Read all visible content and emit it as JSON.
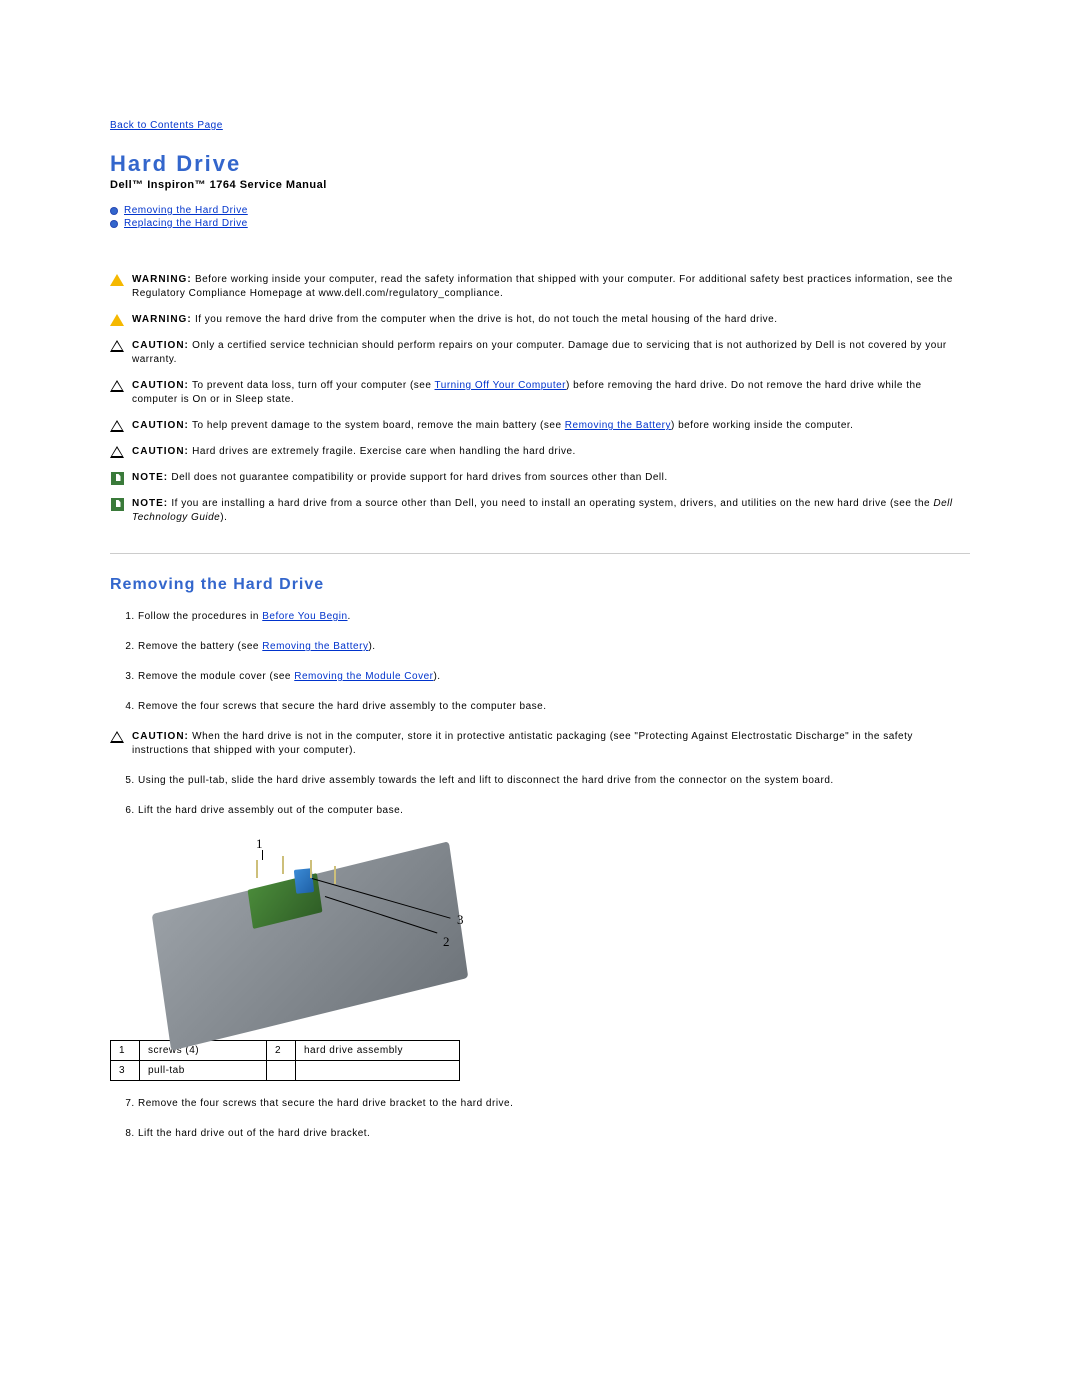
{
  "nav": {
    "contents_link": "Back to Contents Page"
  },
  "title": "Hard Drive",
  "subtitle": "Dell™ Inspiron™ 1764 Service Manual",
  "toc": [
    "Removing the Hard Drive",
    "Replacing the Hard Drive"
  ],
  "admon": {
    "w1_label": "WARNING:",
    "w1_text": "Before working inside your computer, read the safety information that shipped with your computer. For additional safety best practices information, see the Regulatory Compliance Homepage at www.dell.com/regulatory_compliance.",
    "w2_label": "WARNING:",
    "w2_text": "If you remove the hard drive from the computer when the drive is hot, do not touch the metal housing of the hard drive.",
    "c1_label": "CAUTION:",
    "c1_text": "Only a certified service technician should perform repairs on your computer. Damage due to servicing that is not authorized by Dell is not covered by your warranty.",
    "c2_label": "CAUTION:",
    "c2_pre": "To prevent data loss, turn off your computer (see ",
    "c2_link": "Turning Off Your Computer",
    "c2_post": ") before removing the hard drive. Do not remove the hard drive while the computer is On or in Sleep state.",
    "c3_label": "CAUTION:",
    "c3_pre": "To help prevent damage to the system board, remove the main battery (see ",
    "c3_link": "Removing the Battery",
    "c3_post": ") before working inside the computer.",
    "c4_label": "CAUTION:",
    "c4_text": "Hard drives are extremely fragile. Exercise care when handling the hard drive.",
    "n1_label": "NOTE:",
    "n1_text": "Dell does not guarantee compatibility or provide support for hard drives from sources other than Dell.",
    "n2_label": "NOTE:",
    "n2_pre": "If you are installing a hard drive from a source other than Dell, you need to install an operating system, drivers, and utilities on the new hard drive (see the ",
    "n2_italic": "Dell Technology Guide",
    "n2_post": ")."
  },
  "section_title": "Removing the Hard Drive",
  "steps": {
    "s1_pre": "Follow the procedures in ",
    "s1_link": "Before You Begin",
    "s1_post": ".",
    "s2_pre": "Remove the battery (see ",
    "s2_link": "Removing the Battery",
    "s2_post": ").",
    "s3_pre": "Remove the module cover (see ",
    "s3_link": "Removing the Module Cover",
    "s3_post": ").",
    "s4": "Remove the four screws that secure the hard drive assembly to the computer base.",
    "caution_label": "CAUTION:",
    "caution_text": "When the hard drive is not in the computer, store it in protective antistatic packaging (see \"Protecting Against Electrostatic Discharge\" in the safety instructions that shipped with your computer).",
    "s5": "Using the pull-tab, slide the hard drive assembly towards the left and lift to disconnect the hard drive from the connector on the system board.",
    "s6": "Lift the hard drive assembly out of the computer base.",
    "s7": "Remove the four screws that secure the hard drive bracket to the hard drive.",
    "s8": "Lift the hard drive out of the hard drive bracket."
  },
  "callouts": {
    "one": "1",
    "two": "2",
    "three": "3"
  },
  "legend": {
    "r1n": "1",
    "r1t": "screws (4)",
    "r2n": "2",
    "r2t": "hard drive assembly",
    "r3n": "3",
    "r3t": "pull-tab"
  }
}
